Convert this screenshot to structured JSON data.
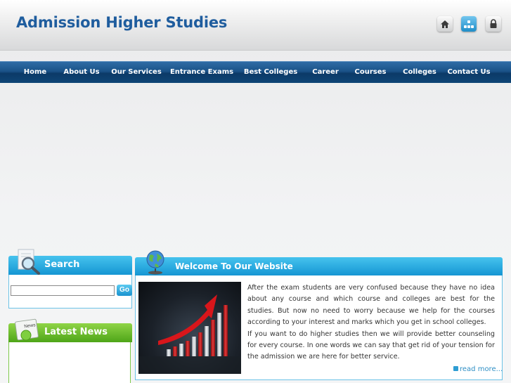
{
  "header": {
    "title": "Admission Higher Studies",
    "icons": [
      "home-icon",
      "sitemap-icon",
      "lock-icon"
    ]
  },
  "nav": {
    "items": [
      "Home",
      "About Us",
      "Our Services",
      "Entrance Exams",
      "Best Colleges",
      "Career",
      "Courses",
      "Colleges",
      "Contact Us"
    ]
  },
  "search": {
    "title": "Search",
    "input_value": "",
    "button_label": "Go"
  },
  "news": {
    "title": "Latest News",
    "icon_label": "News"
  },
  "welcome": {
    "title": "Welcome To Our Website",
    "paragraph1": "After the exam students are very confused because they have no idea about any course and which course and colleges are best for the studies. But now no need to worry because we help for the courses according to your interest and marks which you get in school colleges.",
    "paragraph2": "If you want to do higher studies then we will provide better counseling for every course. In one words we can say that get rid of your tension for the admission we are here for better service.",
    "read_more": "read more..."
  },
  "colors": {
    "title_blue": "#1f5d9e",
    "nav_blue": "#1a5288",
    "panel_blue": "#1596d3",
    "panel_green": "#4ea518"
  }
}
